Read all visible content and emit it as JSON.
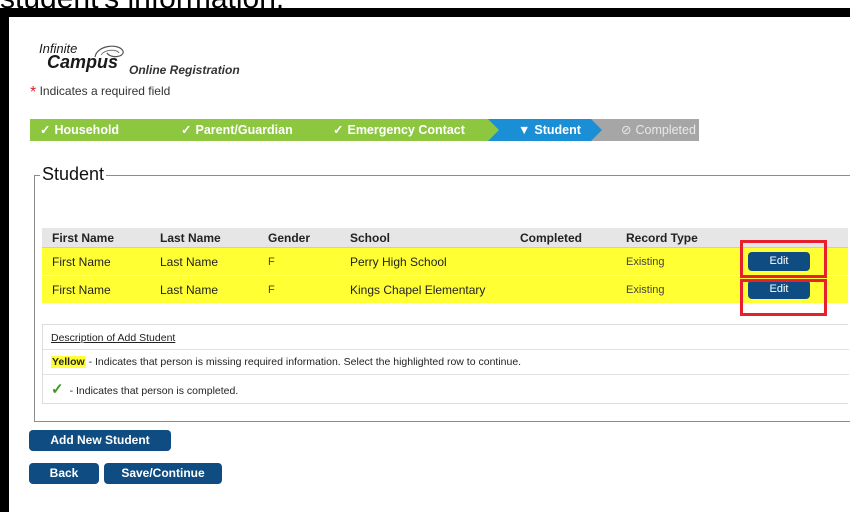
{
  "caption": "student's information.",
  "logo": {
    "line1": "Infinite",
    "line2": "Campus",
    "line3": "Online Registration"
  },
  "required_note": {
    "star": "*",
    "text": "Indicates a required field"
  },
  "steps": [
    {
      "label": "Household",
      "mark": "✓",
      "state": "complete"
    },
    {
      "label": "Parent/Guardian",
      "mark": "✓",
      "state": "complete"
    },
    {
      "label": "Emergency Contact",
      "mark": "✓",
      "state": "complete"
    },
    {
      "label": "Student",
      "mark": "▼",
      "state": "current"
    },
    {
      "label": "Completed",
      "mark": "⊘",
      "state": "disabled"
    }
  ],
  "section_title": "Student",
  "table": {
    "headers": [
      "First Name",
      "Last Name",
      "Gender",
      "School",
      "Completed",
      "Record Type",
      ""
    ],
    "rows": [
      {
        "first": "First Name",
        "last": "Last Name",
        "gender": "F",
        "school": "Perry High School",
        "completed": "",
        "record_type": "Existing",
        "action": "Edit"
      },
      {
        "first": "First Name",
        "last": "Last Name",
        "gender": "F",
        "school": "Kings Chapel Elementary",
        "completed": "",
        "record_type": "Existing",
        "action": "Edit"
      }
    ]
  },
  "description": {
    "title": "Description of Add Student",
    "yellow_word": "Yellow",
    "yellow_text": " - Indicates that person is missing required information. Select the highlighted row to continue.",
    "check_text": "- Indicates that person is completed."
  },
  "buttons": {
    "add": "Add New Student",
    "back": "Back",
    "save": "Save/Continue"
  },
  "colors": {
    "step_green": "#8dc63f",
    "step_blue": "#1a8fd6",
    "step_grey": "#a6a6a6",
    "row_yellow": "#ffff33",
    "button_navy": "#0f4c81",
    "highlight_red": "#e8202e"
  }
}
